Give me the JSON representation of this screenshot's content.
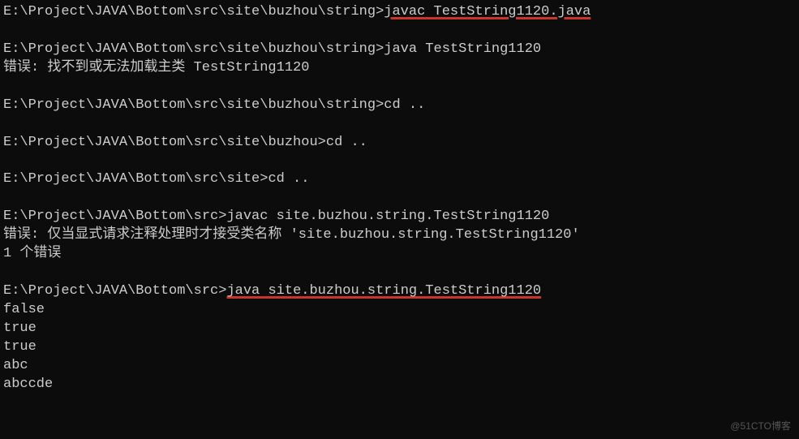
{
  "prompts": {
    "p_string": "E:\\Project\\JAVA\\Bottom\\src\\site\\buzhou\\string>",
    "p_buzhou": "E:\\Project\\JAVA\\Bottom\\src\\site\\buzhou>",
    "p_site": "E:\\Project\\JAVA\\Bottom\\src\\site>",
    "p_src": "E:\\Project\\JAVA\\Bottom\\src>"
  },
  "commands": {
    "javac_file": "javac TestString1120.java",
    "java_short": "java TestString1120",
    "cd_up": "cd ..",
    "javac_pkg": "javac site.buzhou.string.TestString1120",
    "java_pkg": "java site.buzhou.string.TestString1120"
  },
  "outputs": {
    "err1": "错误: 找不到或无法加载主类 TestString1120",
    "err2a": "错误: 仅当显式请求注释处理时才接受类名称 'site.buzhou.string.TestString1120'",
    "err2b": "1 个错误",
    "r1": "false",
    "r2": "true",
    "r3": "true",
    "r4": "abc",
    "r5": "abccde"
  },
  "watermark": "@51CTO博客"
}
